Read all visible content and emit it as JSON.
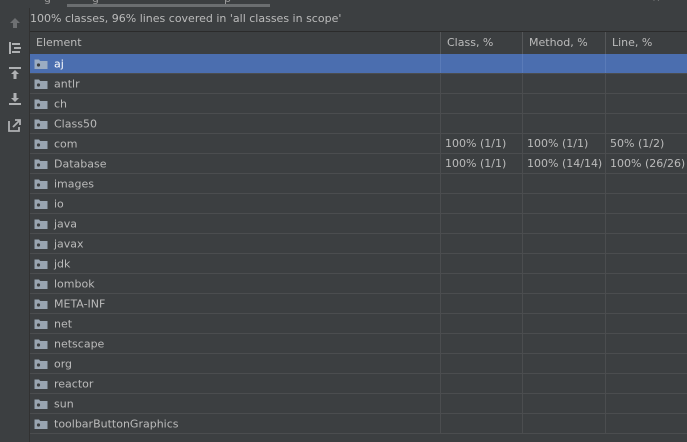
{
  "top_tab": {
    "fragment_left": "g",
    "fragment_mid": "g",
    "fragment_right": "p",
    "close_glyph": "×"
  },
  "summary": "100% classes, 96% lines covered in 'all classes in scope'",
  "sidebar": {
    "buttons": [
      {
        "icon": "up-arrow-icon"
      },
      {
        "icon": "flatten-packages-icon"
      },
      {
        "icon": "import-icon"
      },
      {
        "icon": "export-icon"
      },
      {
        "icon": "generate-report-icon"
      }
    ]
  },
  "table": {
    "headers": [
      "Element",
      "Class, %",
      "Method, %",
      "Line, %"
    ],
    "rows": [
      {
        "name": "aj",
        "class": "",
        "method": "",
        "line": "",
        "selected": true
      },
      {
        "name": "antlr",
        "class": "",
        "method": "",
        "line": ""
      },
      {
        "name": "ch",
        "class": "",
        "method": "",
        "line": ""
      },
      {
        "name": "Class50",
        "class": "",
        "method": "",
        "line": ""
      },
      {
        "name": "com",
        "class": "100% (1/1)",
        "method": "100% (1/1)",
        "line": "50% (1/2)"
      },
      {
        "name": "Database",
        "class": "100% (1/1)",
        "method": "100% (14/14)",
        "line": "100% (26/26)"
      },
      {
        "name": "images",
        "class": "",
        "method": "",
        "line": ""
      },
      {
        "name": "io",
        "class": "",
        "method": "",
        "line": ""
      },
      {
        "name": "java",
        "class": "",
        "method": "",
        "line": ""
      },
      {
        "name": "javax",
        "class": "",
        "method": "",
        "line": ""
      },
      {
        "name": "jdk",
        "class": "",
        "method": "",
        "line": ""
      },
      {
        "name": "lombok",
        "class": "",
        "method": "",
        "line": ""
      },
      {
        "name": "META-INF",
        "class": "",
        "method": "",
        "line": ""
      },
      {
        "name": "net",
        "class": "",
        "method": "",
        "line": ""
      },
      {
        "name": "netscape",
        "class": "",
        "method": "",
        "line": ""
      },
      {
        "name": "org",
        "class": "",
        "method": "",
        "line": ""
      },
      {
        "name": "reactor",
        "class": "",
        "method": "",
        "line": ""
      },
      {
        "name": "sun",
        "class": "",
        "method": "",
        "line": ""
      },
      {
        "name": "toolbarButtonGraphics",
        "class": "",
        "method": "",
        "line": ""
      }
    ]
  },
  "colors": {
    "background": "#3c3f41",
    "selection": "#4b6eaf",
    "text": "#bbbbbb",
    "package_icon": "#a9b7c6"
  }
}
